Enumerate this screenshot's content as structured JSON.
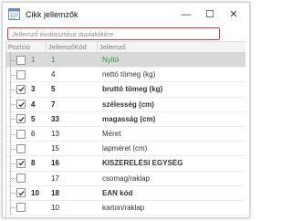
{
  "window": {
    "title": "Cikk jellemzők",
    "controls": {
      "minimize": "—",
      "maximize": "☐",
      "close": "✕"
    }
  },
  "hint": "Jellemző kiválasztása duplaklikkre",
  "grid": {
    "columns": [
      "Pozíció",
      "JellemzőKód",
      "Jellemző"
    ],
    "rows": [
      {
        "checked": false,
        "pos": "1",
        "code": "1",
        "name": "Nyitó",
        "bold": false,
        "style": "green",
        "selected": true
      },
      {
        "checked": false,
        "pos": "",
        "code": "4",
        "name": "nettó tömeg (kg)",
        "bold": false,
        "style": "normal",
        "selected": false
      },
      {
        "checked": true,
        "pos": "3",
        "code": "5",
        "name": "bruttó tömeg (kg)",
        "bold": true,
        "style": "normal",
        "selected": false
      },
      {
        "checked": true,
        "pos": "4",
        "code": "7",
        "name": "szélesség (cm)",
        "bold": true,
        "style": "normal",
        "selected": false
      },
      {
        "checked": true,
        "pos": "5",
        "code": "33",
        "name": "magasság (cm)",
        "bold": true,
        "style": "normal",
        "selected": false
      },
      {
        "checked": false,
        "pos": "6",
        "code": "13",
        "name": "Méret",
        "bold": false,
        "style": "normal",
        "selected": false
      },
      {
        "checked": false,
        "pos": "",
        "code": "15",
        "name": "lapméret (cm)",
        "bold": false,
        "style": "normal",
        "selected": false
      },
      {
        "checked": true,
        "pos": "8",
        "code": "16",
        "name": "KISZERELÉSI EGYSÉG",
        "bold": true,
        "style": "normal",
        "selected": false
      },
      {
        "checked": false,
        "pos": "",
        "code": "17",
        "name": "csomag/raklap",
        "bold": false,
        "style": "normal",
        "selected": false
      },
      {
        "checked": true,
        "pos": "10",
        "code": "18",
        "name": "EAN kód",
        "bold": true,
        "style": "normal",
        "selected": false
      },
      {
        "checked": false,
        "pos": "",
        "code": "10",
        "name": "karton/raklap",
        "bold": false,
        "style": "normal",
        "selected": false
      }
    ]
  }
}
